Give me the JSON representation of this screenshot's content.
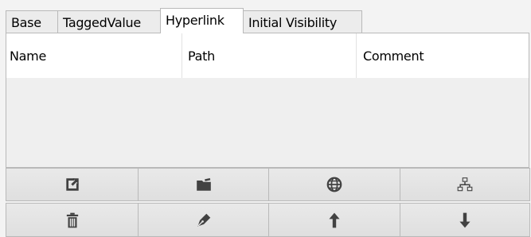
{
  "tabs": [
    {
      "label": "Base",
      "active": false
    },
    {
      "label": "TaggedValue",
      "active": false
    },
    {
      "label": "Hyperlink",
      "active": true
    },
    {
      "label": "Initial Visibility",
      "active": false
    }
  ],
  "table": {
    "columns": [
      "Name",
      "Path",
      "Comment"
    ],
    "rows": []
  },
  "toolbar": {
    "row1": [
      "open-external-icon",
      "folder-icon",
      "globe-icon",
      "hierarchy-icon"
    ],
    "row2": [
      "trash-icon",
      "pen-icon",
      "arrow-up-icon",
      "arrow-down-icon"
    ]
  },
  "colors": {
    "icon": "#424242",
    "border": "#b9b9b9",
    "background": "#f3f3f3"
  }
}
